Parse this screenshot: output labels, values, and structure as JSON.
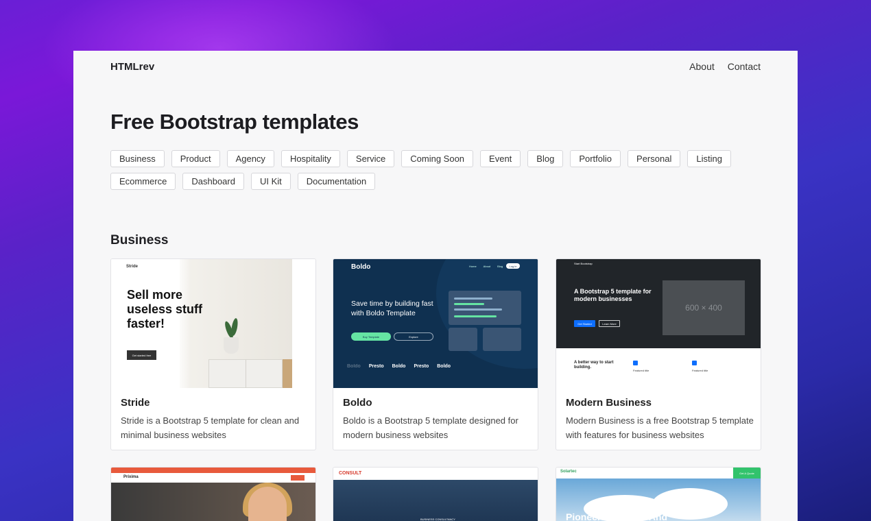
{
  "brand": "HTMLrev",
  "nav": {
    "about": "About",
    "contact": "Contact"
  },
  "page_title": "Free Bootstrap templates",
  "categories": [
    "Business",
    "Product",
    "Agency",
    "Hospitality",
    "Service",
    "Coming Soon",
    "Event",
    "Blog",
    "Portfolio",
    "Personal",
    "Listing",
    "Ecommerce",
    "Dashboard",
    "UI Kit",
    "Documentation"
  ],
  "section": {
    "title": "Business"
  },
  "cards": [
    {
      "name": "Stride",
      "desc": "Stride is a Bootstrap 5 template for clean and minimal business websites",
      "preview": {
        "brand": "Stride",
        "headline_1": "Sell more",
        "headline_2": "useless stuff",
        "headline_3": "faster!",
        "button": "Get started free"
      }
    },
    {
      "name": "Boldo",
      "desc": "Boldo is a Bootstrap 5 template designed for modern business websites",
      "preview": {
        "brand": "Boldo",
        "headline": "Save time by building fast with Boldo Template",
        "primary_button": "Buy Template",
        "secondary_button": "Explore",
        "login": "Log in",
        "menu": [
          "Home",
          "About",
          "Blog"
        ],
        "logos": [
          "Boldo",
          "Presto",
          "Boldo",
          "Presto",
          "Boldo"
        ]
      }
    },
    {
      "name": "Modern Business",
      "desc": "Modern Business is a free Bootstrap 5 template with features for business websites",
      "preview": {
        "brand": "Start Bootstrap",
        "headline": "A Bootstrap 5 template for modern businesses",
        "primary_button": "Get Started",
        "secondary_button": "Learn More",
        "placeholder": "600 × 400",
        "lower_headline": "A better way to start building.",
        "feature_1": "Featured title",
        "feature_2": "Featured title"
      }
    }
  ],
  "bottom_cards": [
    {
      "brand": "Prixima"
    },
    {
      "brand": "CONSULT",
      "caption": "BUSINESS CONSULTANCY"
    },
    {
      "brand": "Solartec",
      "headline": "Pioneers Of Solar And",
      "button": "Get A Quote"
    }
  ]
}
